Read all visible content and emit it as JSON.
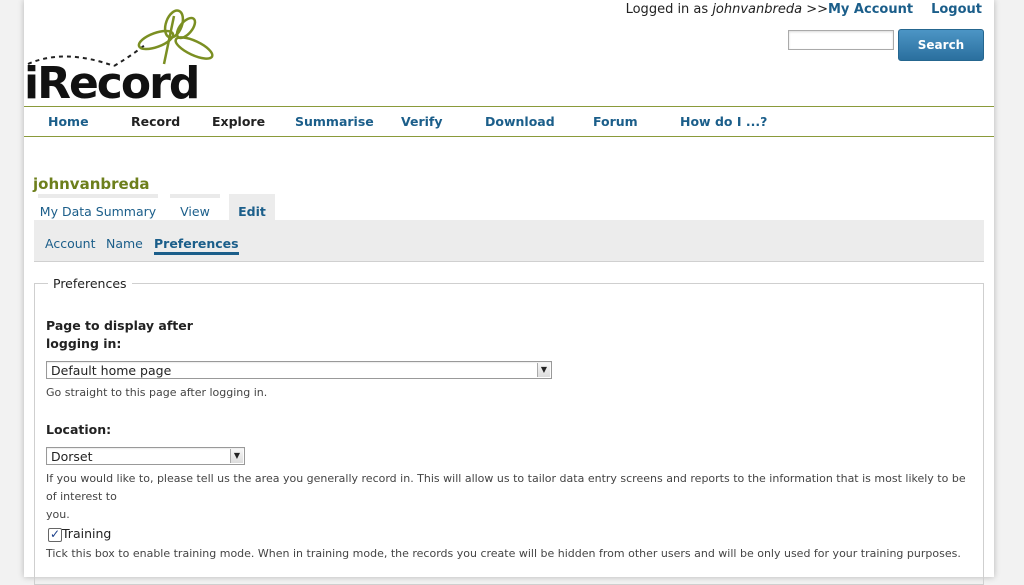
{
  "header": {
    "logo_text": "iRecord",
    "logged_in_prefix": "Logged in as ",
    "username_italic": "johnvanbreda",
    "separator": " >>",
    "my_account": "My Account",
    "logout": "Logout",
    "search_placeholder": "",
    "search_button": "Search"
  },
  "nav": {
    "items": [
      {
        "label": "Home"
      },
      {
        "label": "Record"
      },
      {
        "label": "Explore"
      },
      {
        "label": "Summarise"
      },
      {
        "label": "Verify"
      },
      {
        "label": "Download"
      },
      {
        "label": "Forum"
      },
      {
        "label": "How do I ...?"
      }
    ]
  },
  "user": {
    "title": "johnvanbreda",
    "tabs": [
      {
        "label": "My Data Summary"
      },
      {
        "label": "View"
      },
      {
        "label": "Edit"
      }
    ],
    "subtabs": [
      {
        "label": "Account"
      },
      {
        "label": "Name"
      },
      {
        "label": "Preferences"
      }
    ]
  },
  "form": {
    "legend": "Preferences",
    "page_label_1": "Page to display after",
    "page_label_2": "logging in:",
    "page_value": "Default home page",
    "page_help": "Go straight to this page after logging in.",
    "location_label": "Location:",
    "location_value": "Dorset",
    "location_help_1": "If you would like to, please tell us the area you generally record in. This will allow us to tailor data entry screens and reports to the information that is most likely to be of interest to",
    "location_help_2": "you.",
    "training_label": "Training",
    "training_checked": true,
    "training_help": "Tick this box to enable training mode. When in training mode, the records you create will be hidden from other users and will be only used for your training purposes."
  },
  "colors": {
    "link": "#1b5e8a",
    "brand_green": "#6d7f1c",
    "button_blue": "#2a6f9e"
  }
}
